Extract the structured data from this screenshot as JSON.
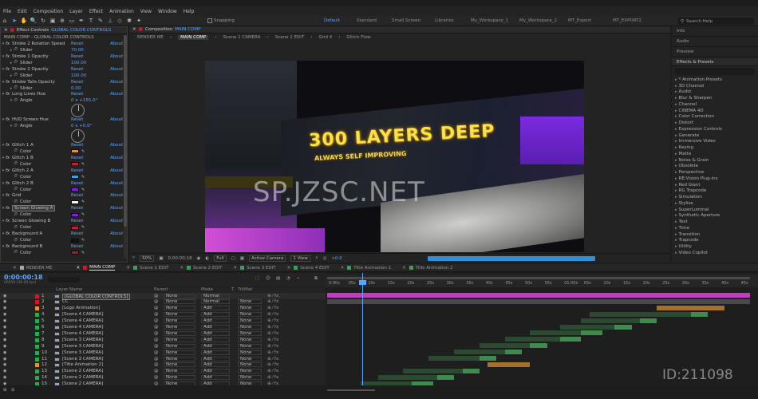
{
  "menu": [
    "File",
    "Edit",
    "Composition",
    "Layer",
    "Effect",
    "Animation",
    "View",
    "Window",
    "Help"
  ],
  "toolbar": {
    "snapping": "Snapping",
    "workspaces": [
      "Default",
      "Standard",
      "Small Screen",
      "Libraries",
      "My_Workspace_1",
      "My_Workspace_2",
      "MT_Export",
      "MT_EXPORT2"
    ],
    "active_workspace": "Default",
    "search_help": "Search Help"
  },
  "effect_controls": {
    "title_prefix": "Effect Controls",
    "title_accent": "GLOBAL COLOR CONTROLS",
    "subtitle": "MAIN COMP - GLOBAL COLOR CONTROLS",
    "reset": "Reset",
    "about": "About",
    "rows": [
      {
        "type": "fx",
        "name": "Stroke 2 Rotation Speed"
      },
      {
        "type": "slider",
        "name": "Slider",
        "value": "70.00"
      },
      {
        "type": "fx",
        "name": "Stroke 1 Opacity"
      },
      {
        "type": "slider",
        "name": "Slider",
        "value": "100.00"
      },
      {
        "type": "fx",
        "name": "Stroke 2 Opacity"
      },
      {
        "type": "slider",
        "name": "Slider",
        "value": "100.00"
      },
      {
        "type": "fx",
        "name": "Stroke Tails Opacity"
      },
      {
        "type": "slider",
        "name": "Slider",
        "value": "0.00"
      },
      {
        "type": "fx",
        "name": "Long Lines Hue"
      },
      {
        "type": "angle",
        "name": "Angle",
        "value": "0 x +155.0°"
      },
      {
        "type": "dial"
      },
      {
        "type": "blank"
      },
      {
        "type": "fx",
        "name": "HUD Screen Hue"
      },
      {
        "type": "angle",
        "name": "Angle",
        "value": "0 x +0.0°"
      },
      {
        "type": "dial"
      },
      {
        "type": "blank"
      },
      {
        "type": "fx",
        "name": "Glitch 1 A"
      },
      {
        "type": "color",
        "name": "Color",
        "swatch": "#e8922a"
      },
      {
        "type": "fx",
        "name": "Glitch 1 B"
      },
      {
        "type": "color",
        "name": "Color",
        "swatch": "#d0182a"
      },
      {
        "type": "fx",
        "name": "Glitch 2 A"
      },
      {
        "type": "color",
        "name": "Color",
        "swatch": "#2ea8e6"
      },
      {
        "type": "fx",
        "name": "Glitch 2 B"
      },
      {
        "type": "color",
        "name": "Color",
        "swatch": "#8a1ae0"
      },
      {
        "type": "fx",
        "name": "Grid"
      },
      {
        "type": "color",
        "name": "Color",
        "swatch": "#f2f2f2"
      },
      {
        "type": "fx",
        "name": "Screen Glowing A",
        "selected": true
      },
      {
        "type": "color",
        "name": "Color",
        "swatch": "#8a1ae0"
      },
      {
        "type": "fx",
        "name": "Screen Glowing B"
      },
      {
        "type": "color",
        "name": "Color",
        "swatch": "#d0182a"
      },
      {
        "type": "fx",
        "name": "Background A"
      },
      {
        "type": "color",
        "name": "Color",
        "swatch": "#141414"
      },
      {
        "type": "fx",
        "name": "Background B"
      },
      {
        "type": "color",
        "name": "Color",
        "swatch": "#b0142a"
      }
    ]
  },
  "composition": {
    "title_prefix": "Composition",
    "title_accent": "MAIN COMP",
    "flow": [
      "RENDER ME",
      "MAIN COMP",
      "Scene 1 CAMERA",
      "Scene 1 EDIT",
      "Grid 4",
      "Glitch Flow"
    ],
    "active_flow": "MAIN COMP",
    "headline": "300 LAYERS DEEP",
    "subline": "ALWAYS SELF IMPROVING",
    "overlay_watermark": "SP.JZSC.NET",
    "footer": {
      "zoom": "50%",
      "timecode": "0:00:00:18",
      "resolution": "Full",
      "camera": "Active Camera",
      "views": "1 View",
      "exposure": "+0.0"
    }
  },
  "right_panel": {
    "tabs": [
      "Info",
      "Audio",
      "Preview"
    ],
    "effects_title": "Effects & Presets",
    "categories": [
      "* Animation Presets",
      "3D Channel",
      "Audio",
      "Blur & Sharpen",
      "Channel",
      "CINEMA 4D",
      "Color Correction",
      "Distort",
      "Expression Controls",
      "Generate",
      "Immersive Video",
      "Keying",
      "Matte",
      "Noise & Grain",
      "Obsolete",
      "Perspective",
      "RE:Vision Plug-ins",
      "Red Giant",
      "RG Trapcode",
      "Simulation",
      "Stylize",
      "SuperLuminal",
      "Synthetic Aperture",
      "Text",
      "Time",
      "Transition",
      "Trapcode",
      "Utility",
      "Video Copilot"
    ]
  },
  "timeline": {
    "tabs": [
      {
        "label": "RENDER ME",
        "color": "#a8a8a8"
      },
      {
        "label": "MAIN COMP",
        "color": "#d0182a",
        "active": true
      },
      {
        "label": "Scene 1 EDIT",
        "color": "#2ea850"
      },
      {
        "label": "Scene 2 EDIT",
        "color": "#2ea850"
      },
      {
        "label": "Scene 3 EDIT",
        "color": "#2ea850"
      },
      {
        "label": "Scene 4 EDIT",
        "color": "#2ea850"
      },
      {
        "label": "Title Animation 1",
        "color": "#2ea850"
      },
      {
        "label": "Title Animation 2",
        "color": "#2ea850"
      }
    ],
    "timecode": "0:00:00:18",
    "timecode_sub": "00018 (30.00 fps)",
    "columns": {
      "layer": "Layer Name",
      "parent": "Parent",
      "mode": "Mode",
      "t": "T",
      "trkmat": "TrkMat"
    },
    "ruler": [
      "0:00s",
      "05s",
      "10s",
      "15s",
      "20s",
      "25s",
      "30s",
      "35s",
      "40s",
      "45s",
      "50s",
      "55s",
      "01:00s",
      "05s",
      "10s",
      "15s",
      "20s",
      "25s",
      "30s",
      "35s",
      "40s",
      "45s"
    ],
    "layers": [
      {
        "num": "1",
        "name": "[GLOBAL COLOR CONTROLS]",
        "label": "#d0182a",
        "parent": "None",
        "mode": "Normal",
        "trkmat": "",
        "selected": true
      },
      {
        "num": "2",
        "name": "CC",
        "label": "#d0182a",
        "parent": "None",
        "mode": "Normal",
        "trkmat": "None"
      },
      {
        "num": "3",
        "name": "[Logo Animation]",
        "label": "#e8922a",
        "parent": "None",
        "mode": "Add",
        "trkmat": "None"
      },
      {
        "num": "4",
        "name": "[Scene 4 CAMERA]",
        "label": "#2ea850",
        "parent": "None",
        "mode": "Add",
        "trkmat": "None"
      },
      {
        "num": "5",
        "name": "[Scene 4 CAMERA]",
        "label": "#2ea850",
        "parent": "None",
        "mode": "Add",
        "trkmat": "None"
      },
      {
        "num": "6",
        "name": "[Scene 4 CAMERA]",
        "label": "#2ea850",
        "parent": "None",
        "mode": "Add",
        "trkmat": "None"
      },
      {
        "num": "7",
        "name": "[Scene 4 CAMERA]",
        "label": "#2ea850",
        "parent": "None",
        "mode": "Add",
        "trkmat": "None"
      },
      {
        "num": "8",
        "name": "[Scene 3 CAMERA]",
        "label": "#2ea850",
        "parent": "None",
        "mode": "Add",
        "trkmat": "None"
      },
      {
        "num": "9",
        "name": "[Scene 3 CAMERA]",
        "label": "#2ea850",
        "parent": "None",
        "mode": "Add",
        "trkmat": "None"
      },
      {
        "num": "10",
        "name": "[Scene 3 CAMERA]",
        "label": "#2ea850",
        "parent": "None",
        "mode": "Add",
        "trkmat": "None"
      },
      {
        "num": "11",
        "name": "[Scene 3 CAMERA]",
        "label": "#2ea850",
        "parent": "None",
        "mode": "Add",
        "trkmat": "None"
      },
      {
        "num": "12",
        "name": "[Title Animation 2]",
        "label": "#e8922a",
        "parent": "None",
        "mode": "Add",
        "trkmat": "None"
      },
      {
        "num": "13",
        "name": "[Scene 2 CAMERA]",
        "label": "#2ea850",
        "parent": "None",
        "mode": "Add",
        "trkmat": "None"
      },
      {
        "num": "14",
        "name": "[Scene 2 CAMERA]",
        "label": "#2ea850",
        "parent": "None",
        "mode": "Add",
        "trkmat": "None"
      },
      {
        "num": "15",
        "name": "[Scene 2 CAMERA]",
        "label": "#2ea850",
        "parent": "None",
        "mode": "Add",
        "trkmat": "None"
      }
    ],
    "watermark_id": "ID:211098"
  }
}
